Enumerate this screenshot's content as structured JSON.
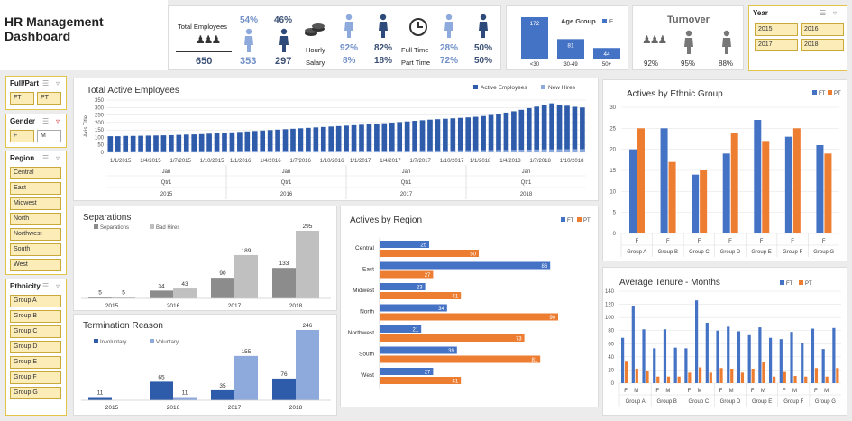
{
  "header": {
    "title": "HR Management Dashboard",
    "total_employees_label": "Total Employees",
    "total_employees": "650",
    "pct_female": "54%",
    "pct_male": "46%",
    "count_female": "353",
    "count_male": "297",
    "hourly_label": "Hourly",
    "salary_label": "Salary",
    "hourly_f": "92%",
    "hourly_m": "82%",
    "salary_f": "8%",
    "salary_m": "18%",
    "fulltime_label": "Full Time",
    "parttime_label": "Part Time",
    "fulltime_f": "28%",
    "fulltime_m": "50%",
    "parttime_f": "72%",
    "parttime_m": "50%",
    "turnover_label": "Turnover",
    "turnover_values": [
      "92%",
      "95%",
      "88%"
    ]
  },
  "age_group": {
    "title": "Age Group",
    "legend": "F",
    "categories": [
      "<30",
      "30-49",
      "50+"
    ],
    "values": [
      172,
      81,
      44
    ]
  },
  "slicers": {
    "year": {
      "label": "Year",
      "options": [
        "2015",
        "2016",
        "2017",
        "2018"
      ]
    },
    "fullpart": {
      "label": "Full/Part",
      "options": [
        "FT",
        "PT"
      ]
    },
    "gender": {
      "label": "Gender",
      "options": [
        "F",
        "M"
      ]
    },
    "region": {
      "label": "Region",
      "options": [
        "Central",
        "East",
        "Midwest",
        "North",
        "Northwest",
        "South",
        "West"
      ]
    },
    "ethnicity": {
      "label": "Ethnicity",
      "options": [
        "Group A",
        "Group B",
        "Group C",
        "Group D",
        "Group E",
        "Group F",
        "Group G"
      ]
    }
  },
  "colors": {
    "blue": "#4472c4",
    "orange": "#ed7d31",
    "darkgray": "#8c8c8c",
    "lightgray": "#c0c0c0",
    "darkblue": "#2e5caa",
    "lightblue": "#8ea9db",
    "slicer_fill": "#fcecb8"
  },
  "chart_data": [
    {
      "type": "bar",
      "title": "Total Active Employees",
      "ylabel": "Axis Title",
      "ylim": [
        0,
        350
      ],
      "yticks": [
        0,
        50,
        100,
        150,
        200,
        250,
        300,
        350
      ],
      "x_tick_labels": [
        "1/1/2015",
        "1/4/2015",
        "1/7/2015",
        "1/10/2015",
        "1/1/2016",
        "1/4/2016",
        "1/7/2016",
        "1/10/2016",
        "1/1/2017",
        "1/4/2017",
        "1/7/2017",
        "1/10/2017",
        "1/1/2018",
        "1/4/2018",
        "1/7/2018",
        "1/10/2018"
      ],
      "month_labels": [
        "Jan",
        "Jan",
        "Jan",
        "Jan"
      ],
      "quarter_labels": [
        "Qtr1",
        "Qtr1",
        "Qtr1",
        "Qtr1"
      ],
      "year_labels": [
        "2015",
        "2016",
        "2017",
        "2018"
      ],
      "series": [
        {
          "name": "Active Employees",
          "values": [
            108,
            108,
            110,
            110,
            111,
            112,
            113,
            114,
            115,
            117,
            119,
            120,
            122,
            125,
            128,
            131,
            134,
            137,
            140,
            143,
            146,
            149,
            152,
            155,
            158,
            161,
            164,
            167,
            170,
            173,
            176,
            179,
            182,
            185,
            188,
            191,
            195,
            199,
            203,
            207,
            211,
            215,
            219,
            222,
            225,
            228,
            231,
            234,
            238,
            243,
            250,
            258,
            266,
            275,
            285,
            296,
            306,
            316,
            328,
            320,
            312,
            305,
            300
          ]
        },
        {
          "name": "New Hires",
          "values": [
            2,
            2,
            2,
            3,
            3,
            3,
            3,
            3,
            3,
            3,
            3,
            3,
            4,
            4,
            4,
            5,
            5,
            5,
            6,
            6,
            6,
            7,
            7,
            7,
            7,
            8,
            8,
            8,
            8,
            9,
            9,
            9,
            10,
            10,
            10,
            11,
            11,
            11,
            12,
            12,
            12,
            13,
            13,
            13,
            13,
            13,
            14,
            14,
            14,
            15,
            15,
            16,
            16,
            17,
            18,
            18,
            19,
            20,
            20,
            21,
            21,
            22,
            22
          ]
        }
      ]
    },
    {
      "type": "bar",
      "title": "Separations",
      "categories": [
        "2015",
        "2016",
        "2017",
        "2018"
      ],
      "series": [
        {
          "name": "Separations",
          "values": [
            5,
            34,
            90,
            133
          ]
        },
        {
          "name": "Bad Hires",
          "values": [
            5,
            43,
            189,
            295
          ]
        }
      ]
    },
    {
      "type": "bar",
      "title": "Termination Reason",
      "categories": [
        "2015",
        "2016",
        "2017",
        "2018"
      ],
      "series": [
        {
          "name": "Involuntary",
          "values": [
            11,
            65,
            35,
            76
          ]
        },
        {
          "name": "Voluntary",
          "values": [
            0,
            11,
            155,
            246
          ]
        }
      ]
    },
    {
      "type": "bar",
      "title": "Actives by Region",
      "categories": [
        "Central",
        "East",
        "Midwest",
        "North",
        "Northwest",
        "South",
        "West"
      ],
      "series": [
        {
          "name": "FT",
          "values": [
            25,
            86,
            23,
            34,
            21,
            39,
            27
          ]
        },
        {
          "name": "PT",
          "values": [
            50,
            27,
            41,
            90,
            73,
            81,
            41
          ]
        }
      ]
    },
    {
      "type": "bar",
      "title": "Actives by Ethnic Group",
      "ylim": [
        0,
        30
      ],
      "yticks": [
        0,
        5,
        10,
        15,
        20,
        25,
        30
      ],
      "categories": [
        "Group A",
        "Group B",
        "Group C",
        "Group D",
        "Group E",
        "Group F",
        "Group G"
      ],
      "sub_label": "F",
      "series": [
        {
          "name": "FT",
          "values": [
            20,
            25,
            14,
            19,
            27,
            23,
            21
          ]
        },
        {
          "name": "PT",
          "values": [
            25,
            17,
            15,
            24,
            22,
            25,
            19
          ]
        }
      ]
    },
    {
      "type": "bar",
      "title": "Average Tenure - Months",
      "ylim": [
        0,
        140
      ],
      "yticks": [
        0,
        20,
        40,
        60,
        80,
        100,
        120,
        140
      ],
      "categories": [
        "Group A",
        "Group B",
        "Group C",
        "Group D",
        "Group E",
        "Group F",
        "Group G"
      ],
      "sub_labels": [
        "F",
        "M"
      ],
      "series": [
        {
          "name": "FT",
          "values": [
            69,
            118,
            82,
            53,
            82,
            54,
            53,
            126,
            92,
            80,
            86,
            79,
            73,
            85,
            69,
            67,
            78,
            61,
            83,
            52,
            84
          ]
        },
        {
          "name": "PT",
          "values": [
            34,
            22,
            18,
            10,
            10,
            10,
            16,
            24,
            16,
            23,
            22,
            16,
            22,
            32,
            10,
            17,
            11,
            10,
            23,
            10,
            23
          ]
        }
      ]
    }
  ]
}
